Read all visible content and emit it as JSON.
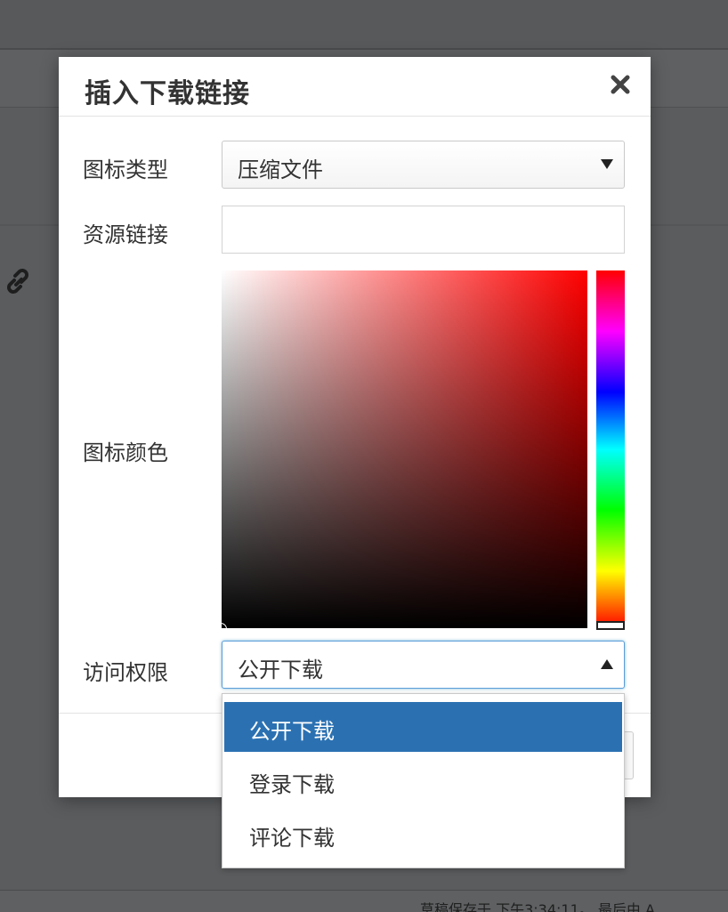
{
  "dialog": {
    "title": "插入下载链接",
    "close_icon": "close-icon"
  },
  "form": {
    "icon_type": {
      "label": "图标类型",
      "value": "压缩文件"
    },
    "resource_link": {
      "label": "资源链接",
      "value": ""
    },
    "icon_color": {
      "label": "图标颜色",
      "hue": "#ff0000"
    },
    "access": {
      "label": "访问权限",
      "value": "公开下载",
      "options": [
        "公开下载",
        "登录下载",
        "评论下载"
      ],
      "selected_index": 0
    }
  },
  "background": {
    "status_text": "草稿保存于 下午3:34:11。 最后由 A"
  },
  "colors": {
    "selected_option": "#2b71b2",
    "overlay": "#5a5c5e"
  }
}
